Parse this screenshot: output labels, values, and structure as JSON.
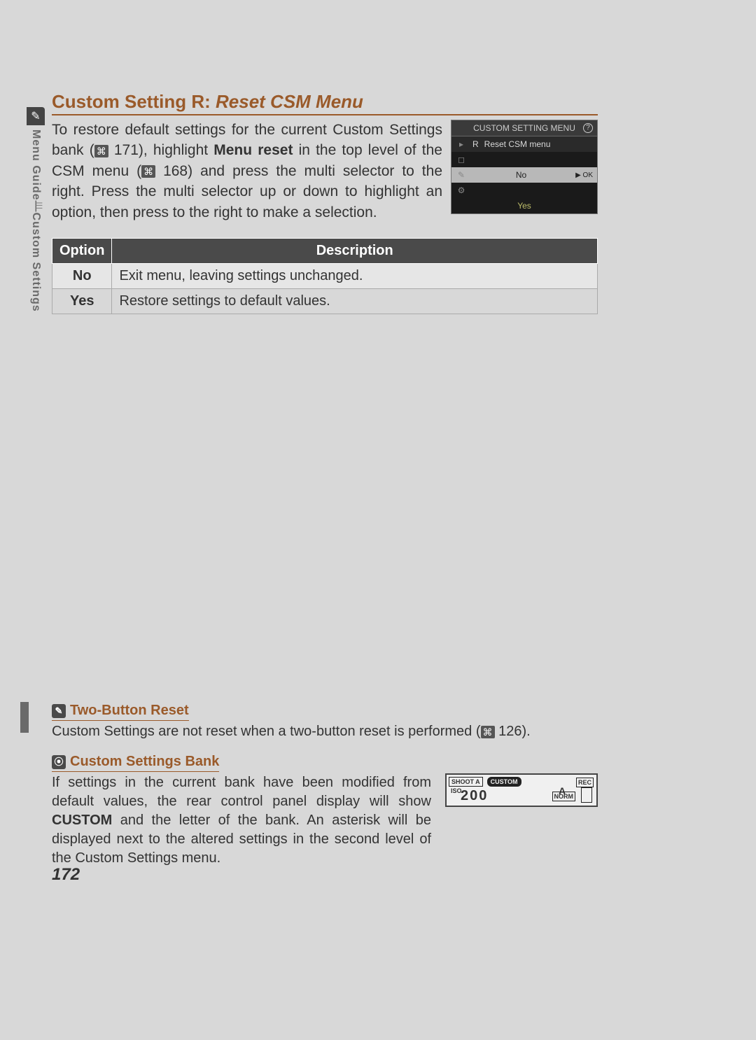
{
  "sidebar": {
    "icon_glyph": "✎",
    "label": "Menu Guide—Custom Settings"
  },
  "heading": {
    "prefix": "Custom Setting R: ",
    "italic": "Reset CSM Menu"
  },
  "intro": {
    "t1": "To restore default settings for the current Custom Settings bank (",
    "ref1": "171",
    "t2": "), highlight ",
    "bold1": "Menu reset",
    "t3": " in the top level of the CSM menu (",
    "ref2": "168",
    "t4": ") and press the multi selector to the right.  Press the multi selector up or down to highlight an option, then press to the right to make a selection."
  },
  "menu_screenshot": {
    "title": "CUSTOM SETTING MENU",
    "row_r": "R",
    "row_r_label": "Reset CSM menu",
    "no": "No",
    "ok": "▶ OK",
    "yes": "Yes",
    "icons": [
      "▸",
      "◻",
      "✎",
      "⚙",
      "☰"
    ]
  },
  "table": {
    "head_option": "Option",
    "head_desc": "Description",
    "rows": [
      {
        "opt": "No",
        "desc": "Exit menu, leaving settings unchanged."
      },
      {
        "opt": "Yes",
        "desc": "Restore settings to default values."
      }
    ]
  },
  "notes": {
    "two_button": {
      "heading": "Two-Button Reset",
      "body_a": "Custom Settings are not reset when a two-button reset is performed (",
      "ref": "126",
      "body_b": ")."
    },
    "bank": {
      "heading": "Custom Settings Bank",
      "body_a": "If settings in the current bank have been modified from default values, the rear control panel display will show ",
      "bold": "CUSTOM",
      "body_b": " and the letter of the bank.  An asterisk will be displayed next to the altered settings in the second level of the Custom Settings menu."
    },
    "panel": {
      "shoot": "SHOOT A",
      "iso": "ISO",
      "custom": "CUSTOM",
      "big": "200",
      "norm": "NORM",
      "rec": "REC",
      "letter": "A"
    }
  },
  "page_number": "172"
}
